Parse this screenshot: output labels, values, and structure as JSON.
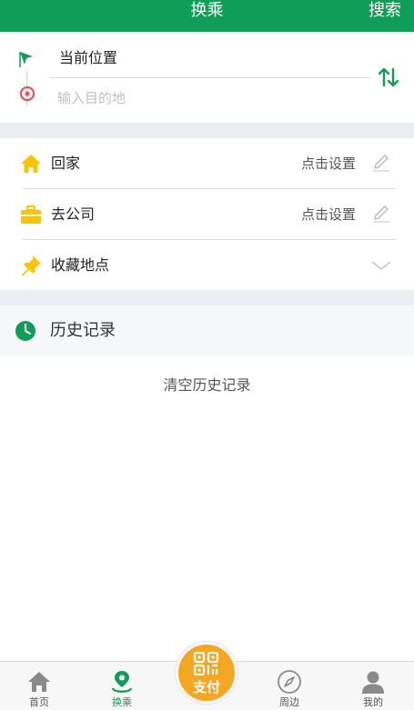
{
  "header": {
    "title": "换乘",
    "search_label": "搜索"
  },
  "route": {
    "origin": "当前位置",
    "destination_placeholder": "输入目的地",
    "destination_value": ""
  },
  "places": [
    {
      "label": "回家",
      "action": "点击设置",
      "icon": "home-icon"
    },
    {
      "label": "去公司",
      "action": "点击设置",
      "icon": "briefcase-icon"
    },
    {
      "label": "收藏地点",
      "icon": "pin-icon"
    }
  ],
  "history": {
    "title": "历史记录",
    "clear_label": "清空历史记录"
  },
  "tabbar": {
    "tabs": [
      {
        "label": "首页",
        "icon": "home-icon"
      },
      {
        "label": "换乘",
        "icon": "transfer-icon",
        "active": true
      },
      {
        "label": "周边",
        "icon": "compass-icon"
      },
      {
        "label": "我的",
        "icon": "person-icon"
      }
    ],
    "pay_label": "支付"
  },
  "colors": {
    "brand": "#0f9d58",
    "accent": "#f5a623",
    "icon_yellow": "#f7c600",
    "destination_marker": "#e8535a"
  }
}
